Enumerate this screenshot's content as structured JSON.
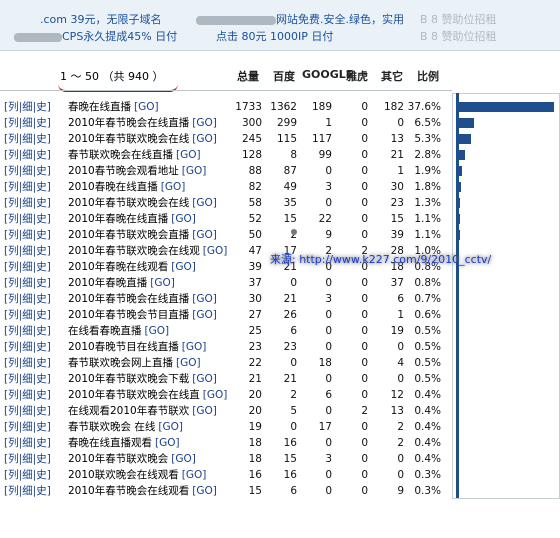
{
  "top_ads": {
    "line1_left": ".com 39元，无限子域名",
    "line1_mid": "网站免费.安全.绿色，实用",
    "line1_right": "B 8 赞助位招租",
    "line2_left": "CPS永久提成45% 日付",
    "line2_mid": "点击 80元 1000IP 日付",
    "line2_right": "B 8 赞助位招租"
  },
  "range_label": "1 ～ 50 （共 940 ）",
  "columns": {
    "total": "总量",
    "baidu": "百度",
    "google": "GOOGLE",
    "yahoo": "雅虎",
    "other": "其它",
    "ratio": "比例"
  },
  "row_links": {
    "list": "[列",
    "detail": "|细",
    "history": "|史]",
    "go": "[GO]"
  },
  "rows": [
    {
      "kw": "春晚在线直播",
      "total": "1733",
      "baidu": "1362",
      "google": "189",
      "yahoo": "0",
      "other": "182",
      "ratio": "37.6%",
      "bar": 1.0
    },
    {
      "kw": "2010年春节晚会在线直播",
      "total": "300",
      "baidu": "299",
      "google": "1",
      "yahoo": "0",
      "other": "0",
      "ratio": "6.5%",
      "bar": 0.18
    },
    {
      "kw": "2010年春节联欢晚会在线",
      "total": "245",
      "baidu": "115",
      "google": "117",
      "yahoo": "0",
      "other": "13",
      "ratio": "5.3%",
      "bar": 0.15
    },
    {
      "kw": "春节联欢晚会在线直播",
      "total": "128",
      "baidu": "8",
      "google": "99",
      "yahoo": "0",
      "other": "21",
      "ratio": "2.8%",
      "bar": 0.09
    },
    {
      "kw": "2010春节晚会观看地址",
      "total": "88",
      "baidu": "87",
      "google": "0",
      "yahoo": "0",
      "other": "1",
      "ratio": "1.9%",
      "bar": 0.06
    },
    {
      "kw": "2010春晚在线直播",
      "total": "82",
      "baidu": "49",
      "google": "3",
      "yahoo": "0",
      "other": "30",
      "ratio": "1.8%",
      "bar": 0.055
    },
    {
      "kw": "2010年春节联欢晚会在线",
      "total": "58",
      "baidu": "35",
      "google": "0",
      "yahoo": "0",
      "other": "23",
      "ratio": "1.3%",
      "bar": 0.045
    },
    {
      "kw": "2010年春晚在线直播",
      "total": "52",
      "baidu": "15",
      "google": "22",
      "yahoo": "0",
      "other": "15",
      "ratio": "1.1%",
      "bar": 0.04
    },
    {
      "kw": "2010年春节联欢晚会直播",
      "total": "50",
      "baidu": "2",
      "google": "9",
      "yahoo": "0",
      "other": "39",
      "ratio": "1.1%",
      "bar": 0.04
    },
    {
      "kw": "2010年春节联欢晚会在线观",
      "total": "47",
      "baidu": "17",
      "google": "2",
      "yahoo": "2",
      "other": "28",
      "ratio": "1.0%",
      "bar": 0.035
    },
    {
      "kw": "2010年春晚在线观看",
      "total": "39",
      "baidu": "21",
      "google": "0",
      "yahoo": "0",
      "other": "18",
      "ratio": "0.8%",
      "bar": 0.03
    },
    {
      "kw": "2010年春晚直播",
      "total": "37",
      "baidu": "0",
      "google": "0",
      "yahoo": "0",
      "other": "37",
      "ratio": "0.8%",
      "bar": 0.03
    },
    {
      "kw": "2010年春节晚会在线直播",
      "total": "30",
      "baidu": "21",
      "google": "3",
      "yahoo": "0",
      "other": "6",
      "ratio": "0.7%",
      "bar": 0.025
    },
    {
      "kw": "2010年春节晚会节目直播",
      "total": "27",
      "baidu": "26",
      "google": "0",
      "yahoo": "0",
      "other": "1",
      "ratio": "0.6%",
      "bar": 0.02
    },
    {
      "kw": "在线看春晚直播",
      "total": "25",
      "baidu": "6",
      "google": "0",
      "yahoo": "0",
      "other": "19",
      "ratio": "0.5%",
      "bar": 0.02
    },
    {
      "kw": "2010春晚节目在线直播",
      "total": "23",
      "baidu": "23",
      "google": "0",
      "yahoo": "0",
      "other": "0",
      "ratio": "0.5%",
      "bar": 0.018
    },
    {
      "kw": "春节联欢晚会网上直播",
      "total": "22",
      "baidu": "0",
      "google": "18",
      "yahoo": "0",
      "other": "4",
      "ratio": "0.5%",
      "bar": 0.018
    },
    {
      "kw": "2010年春节联欢晚会下载",
      "total": "21",
      "baidu": "21",
      "google": "0",
      "yahoo": "0",
      "other": "0",
      "ratio": "0.5%",
      "bar": 0.017
    },
    {
      "kw": "2010年春节联欢晚会在线直",
      "total": "20",
      "baidu": "2",
      "google": "6",
      "yahoo": "0",
      "other": "12",
      "ratio": "0.4%",
      "bar": 0.016
    },
    {
      "kw": "在线观看2010年春节联欢",
      "total": "20",
      "baidu": "5",
      "google": "0",
      "yahoo": "2",
      "other": "13",
      "ratio": "0.4%",
      "bar": 0.016
    },
    {
      "kw": "春节联欢晚会 在线",
      "total": "19",
      "baidu": "0",
      "google": "17",
      "yahoo": "0",
      "other": "2",
      "ratio": "0.4%",
      "bar": 0.015
    },
    {
      "kw": "春晚在线直播观看",
      "total": "18",
      "baidu": "16",
      "google": "0",
      "yahoo": "0",
      "other": "2",
      "ratio": "0.4%",
      "bar": 0.015
    },
    {
      "kw": "2010年春节联欢晚会",
      "total": "18",
      "baidu": "15",
      "google": "3",
      "yahoo": "0",
      "other": "0",
      "ratio": "0.4%",
      "bar": 0.015
    },
    {
      "kw": "2010联欢晚会在线观看",
      "total": "16",
      "baidu": "16",
      "google": "0",
      "yahoo": "0",
      "other": "0",
      "ratio": "0.3%",
      "bar": 0.013
    },
    {
      "kw": "2010年春节晚会在线观看",
      "total": "15",
      "baidu": "6",
      "google": "0",
      "yahoo": "0",
      "other": "9",
      "ratio": "0.3%",
      "bar": 0.012
    }
  ],
  "watermark": "来源: http://www.k227.com/9/2010_cctv/",
  "colors": {
    "link": "#1a3f8a",
    "bar": "#1f4e8c",
    "underline": "#d40000"
  }
}
